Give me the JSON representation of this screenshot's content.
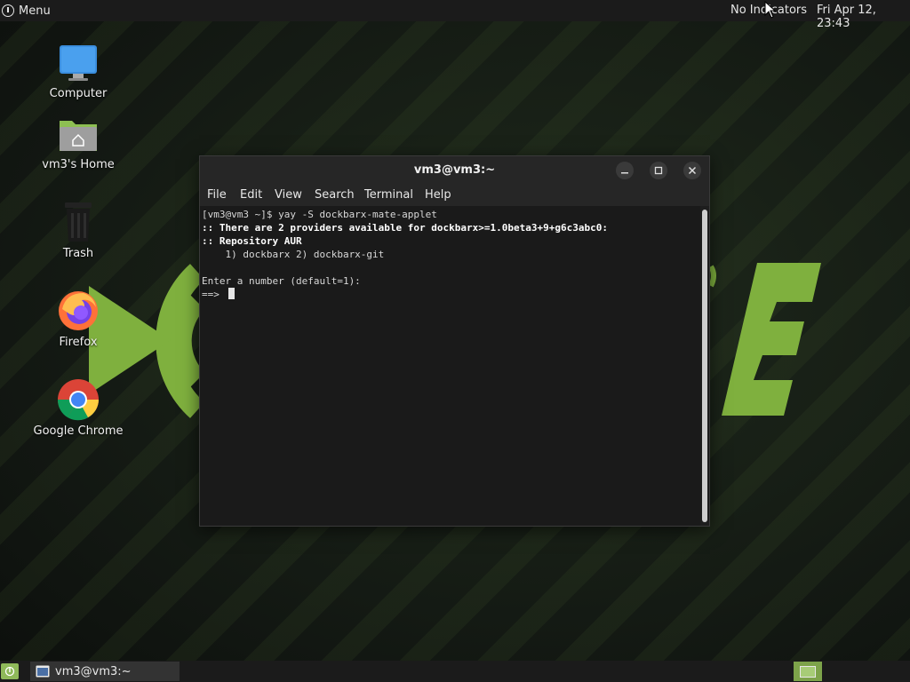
{
  "top_panel": {
    "menu_label": "Menu",
    "indicators": "No Indicators",
    "clock": "Fri Apr 12, 23:43"
  },
  "desktop_icons": [
    {
      "label": "Computer",
      "icon": "computer-icon"
    },
    {
      "label": "vm3's Home",
      "icon": "home-folder-icon"
    },
    {
      "label": "Trash",
      "icon": "trash-icon"
    },
    {
      "label": "Firefox",
      "icon": "firefox-icon"
    },
    {
      "label": "Google Chrome",
      "icon": "chrome-icon"
    }
  ],
  "terminal": {
    "title": "vm3@vm3:~",
    "menu": [
      "File",
      "Edit",
      "View",
      "Search",
      "Terminal",
      "Help"
    ],
    "lines": [
      "[vm3@vm3 ~]$ yay -S dockbarx-mate-applet",
      ":: There are 2 providers available for dockbarx>=1.0beta3+9+g6c3abc0:",
      ":: Repository AUR",
      "    1) dockbarx 2) dockbarx-git",
      "",
      "Enter a number (default=1):",
      "==> "
    ]
  },
  "bottom_panel": {
    "task_label": "vm3@vm3:~"
  },
  "colors": {
    "accent": "#8fb95a",
    "panel": "#1b1b1b",
    "terminal_bg": "#1a1a1a"
  }
}
